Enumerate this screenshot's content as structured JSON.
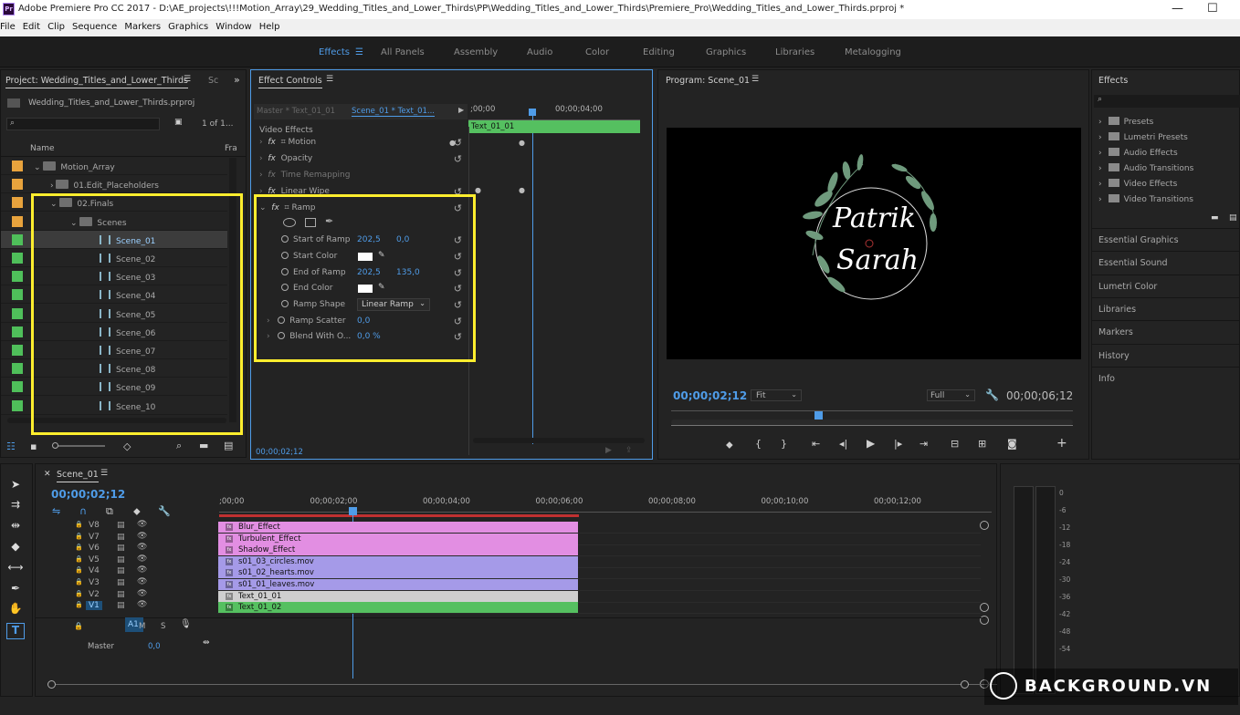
{
  "window": {
    "title": "Adobe Premiere Pro CC 2017 - D:\\AE_projects\\!!!Motion_Array\\29_Wedding_Titles_and_Lower_Thirds\\PP\\Wedding_Titles_and_Lower_Thirds\\Premiere_Pro\\Wedding_Titles_and_Lower_Thirds.prproj *",
    "app_icon": "Pr"
  },
  "menu": [
    "File",
    "Edit",
    "Clip",
    "Sequence",
    "Markers",
    "Graphics",
    "Window",
    "Help"
  ],
  "workspaces": [
    "Effects",
    "All Panels",
    "Assembly",
    "Audio",
    "Color",
    "Editing",
    "Graphics",
    "Libraries",
    "Metalogging"
  ],
  "project": {
    "tab": "Project: Wedding_Titles_and_Lower_Thirds",
    "tab2": "Sc",
    "file": "Wedding_Titles_and_Lower_Thirds.prproj",
    "count": "1 of 1...",
    "col_name": "Name",
    "col_fr": "Fra",
    "items": [
      {
        "label": "Motion_Array",
        "type": "folder",
        "color": "#e8a33d"
      },
      {
        "label": "01.Edit_Placeholders",
        "type": "folder",
        "color": "#e8a33d"
      },
      {
        "label": "02.Finals",
        "type": "folder",
        "color": "#e8a33d"
      },
      {
        "label": "Scenes",
        "type": "folder",
        "color": "#e8a33d"
      },
      {
        "label": "Scene_01",
        "type": "seq",
        "color": "#4fbf5a"
      },
      {
        "label": "Scene_02",
        "type": "seq",
        "color": "#4fbf5a"
      },
      {
        "label": "Scene_03",
        "type": "seq",
        "color": "#4fbf5a"
      },
      {
        "label": "Scene_04",
        "type": "seq",
        "color": "#4fbf5a"
      },
      {
        "label": "Scene_05",
        "type": "seq",
        "color": "#4fbf5a"
      },
      {
        "label": "Scene_06",
        "type": "seq",
        "color": "#4fbf5a"
      },
      {
        "label": "Scene_07",
        "type": "seq",
        "color": "#4fbf5a"
      },
      {
        "label": "Scene_08",
        "type": "seq",
        "color": "#4fbf5a"
      },
      {
        "label": "Scene_09",
        "type": "seq",
        "color": "#4fbf5a"
      },
      {
        "label": "Scene_10",
        "type": "seq",
        "color": "#4fbf5a"
      }
    ]
  },
  "effect_controls": {
    "tab": "Effect Controls",
    "master": "Master * Text_01_01",
    "seq": "Scene_01 * Text_01...",
    "t1": ";00;00",
    "t2": "00;00;04;00",
    "clip": "Text_01_01",
    "section": "Video Effects",
    "rows": [
      "Motion",
      "Opacity",
      "Time Remapping",
      "Linear Wipe",
      "Ramp"
    ],
    "ramp": {
      "start_label": "Start of Ramp",
      "start_x": "202,5",
      "start_y": "0,0",
      "start_color": "Start Color",
      "end_label": "End of Ramp",
      "end_x": "202,5",
      "end_y": "135,0",
      "end_color": "End Color",
      "shape_label": "Ramp Shape",
      "shape_val": "Linear Ramp",
      "scatter_label": "Ramp Scatter",
      "scatter_val": "0,0",
      "blend_label": "Blend With O...",
      "blend_val": "0,0 %"
    },
    "timecode": "00;00;02;12"
  },
  "program": {
    "tab": "Program: Scene_01",
    "name1": "Patrik",
    "name2": "Sarah",
    "timecode": "00;00;02;12",
    "fit": "Fit",
    "full": "Full",
    "duration": "00;00;06;12"
  },
  "effects_panel": {
    "tab": "Effects",
    "items": [
      "Presets",
      "Lumetri Presets",
      "Audio Effects",
      "Audio Transitions",
      "Video Effects",
      "Video Transitions"
    ]
  },
  "side_panels": [
    "Essential Graphics",
    "Essential Sound",
    "Lumetri Color",
    "Libraries",
    "Markers",
    "History",
    "Info"
  ],
  "timeline": {
    "tab": "Scene_01",
    "timecode": "00;00;02;12",
    "ruler": [
      ";00;00",
      "00;00;02;00",
      "00;00;04;00",
      "00;00;06;00",
      "00;00;08;00",
      "00;00;10;00",
      "00;00;12;00"
    ],
    "tracks": [
      "V8",
      "V7",
      "V6",
      "V5",
      "V4",
      "V3",
      "V2",
      "V1"
    ],
    "clips": [
      {
        "label": "Blur_Effect",
        "color": "#e28ee2"
      },
      {
        "label": "Turbulent_Effect",
        "color": "#e28ee2"
      },
      {
        "label": "Shadow_Effect",
        "color": "#e28ee2"
      },
      {
        "label": "s01_03_circles.mov",
        "color": "#a59ae8"
      },
      {
        "label": "s01_02_hearts.mov",
        "color": "#a59ae8"
      },
      {
        "label": "s01_01_leaves.mov",
        "color": "#a59ae8"
      },
      {
        "label": "Text_01_01",
        "color": "#cfcfcf"
      },
      {
        "label": "Text_01_02",
        "color": "#55c060"
      }
    ],
    "audio_track": "A1",
    "m": "M",
    "s": "S",
    "master": "Master",
    "master_val": "0,0"
  },
  "meter": [
    "0",
    "-6",
    "-12",
    "-18",
    "-24",
    "-30",
    "-36",
    "-42",
    "-48",
    "-54"
  ],
  "watermark": "BACKGROUND.VN"
}
